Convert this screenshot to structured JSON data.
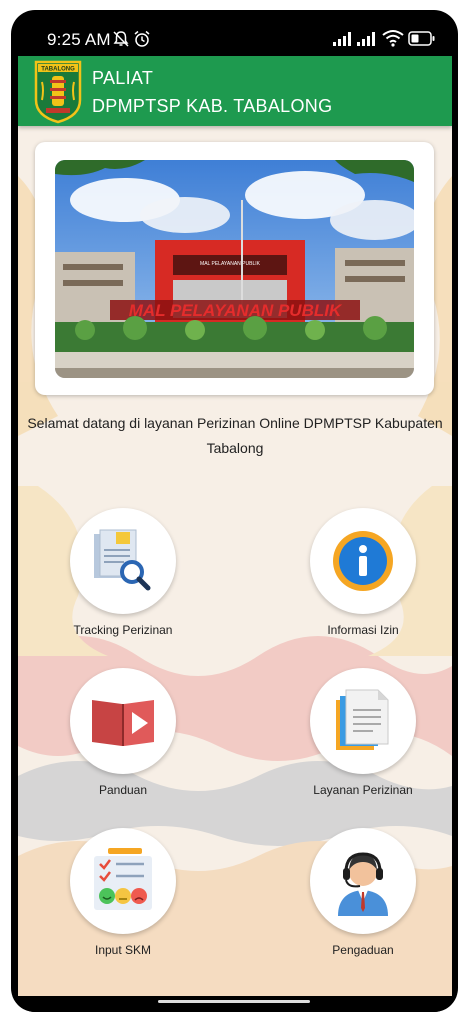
{
  "status_bar": {
    "time": "9:25 AM",
    "icons": [
      "mute-icon",
      "alarm-icon",
      "signal-icon",
      "signal-icon",
      "wifi-icon",
      "battery-icon"
    ]
  },
  "app_bar": {
    "title_line1": "PALIAT",
    "title_line2": "DPMPTSP KAB. TABALONG",
    "logo_text": "TABALONG",
    "bg_color": "#1e9a4f"
  },
  "banner": {
    "sign_text": "MAL PELAYANAN PUBLIK",
    "small_text": "MAL PELAYANAN PUBLIK"
  },
  "welcome": {
    "text": "Selamat datang di layanan Perizinan Online DPMPTSP Kabupaten Tabalong"
  },
  "menu": [
    {
      "label": "Tracking Perizinan",
      "icon": "document-search-icon"
    },
    {
      "label": "Informasi Izin",
      "icon": "info-icon"
    },
    {
      "label": "Panduan",
      "icon": "book-play-icon"
    },
    {
      "label": "Layanan Perizinan",
      "icon": "documents-icon"
    },
    {
      "label": "Input SKM",
      "icon": "survey-icon"
    },
    {
      "label": "Pengaduan",
      "icon": "customer-service-icon"
    }
  ]
}
